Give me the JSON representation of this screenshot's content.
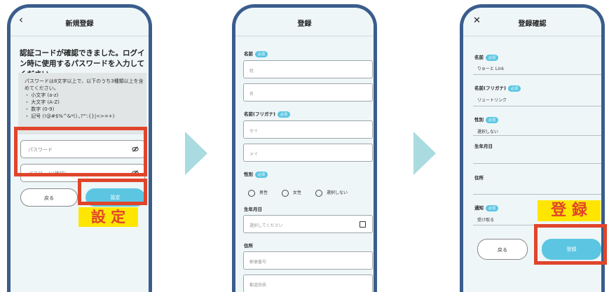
{
  "colors": {
    "frame": "#3a5d8c",
    "screen": "#eef6f8",
    "accent": "#5cc6e2",
    "highlight": "#e0452c",
    "annotation_bg": "#ffe600",
    "arrow": "#a9dbe0"
  },
  "screen1": {
    "title": "新規登録",
    "back_icon": "chevron-left-icon",
    "heading": "認証コードが確認できました。ログイン時に使用するパスワードを入力してください。",
    "rules": [
      "パスワードは8文字以上で、以下のうち3種類以上を含",
      "めてください。",
      "・ 小文字 (a-z)",
      "・ 大文字 (A-Z)",
      "・ 数字 (0-9)",
      "・ 記号 (!@#$%^&*().,?\"':{}|<>=+)"
    ],
    "password_placeholder": "パスワード",
    "password_confirm_placeholder": "パスワード(確認)",
    "back_button": "戻る",
    "set_button": "設定",
    "annotation": "設 定"
  },
  "screen2": {
    "title": "登録",
    "required_badge": "必須",
    "name_label": "名前",
    "last_name_placeholder": "姓",
    "first_name_placeholder": "名",
    "kana_label": "名前(フリガナ)",
    "last_kana_placeholder": "セイ",
    "first_kana_placeholder": "メイ",
    "gender_label": "性別",
    "gender_options": [
      "男性",
      "女性",
      "選択しない"
    ],
    "birth_label": "生年月日",
    "birth_placeholder": "選択してください",
    "address_label": "住所",
    "postal_placeholder": "郵便番号",
    "prefecture_placeholder": "都道府県"
  },
  "screen3": {
    "title": "登録確認",
    "close_icon": "close-icon",
    "required_badge": "必須",
    "name_label": "名前",
    "name_value": "りゅーと Link",
    "kana_label": "名前(フリガナ)",
    "kana_value": "リュートリンク",
    "gender_label": "性別",
    "gender_value": "選択しない",
    "birth_label": "生年月日",
    "address_label": "住所",
    "notify_label": "通知",
    "notify_value": "受け取る",
    "back_button": "戻る",
    "register_button": "登録",
    "annotation": "登 録"
  }
}
